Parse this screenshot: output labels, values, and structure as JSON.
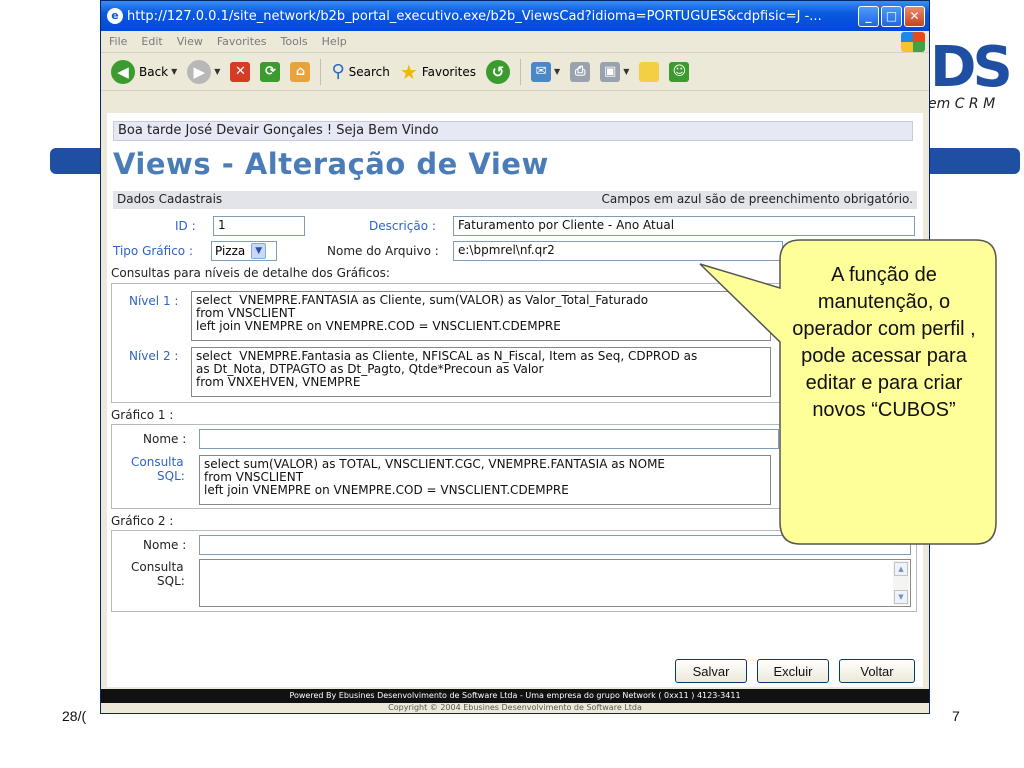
{
  "browser": {
    "title": "http://127.0.0.1/site_network/b2b_portal_executivo.exe/b2b_ViewsCad?idioma=PORTUGUES&cdpfisic=J -...",
    "menu": [
      "File",
      "Edit",
      "View",
      "Favorites",
      "Tools",
      "Help"
    ],
    "toolbar": {
      "back": "Back",
      "search": "Search",
      "favorites": "Favorites"
    }
  },
  "page": {
    "greeting": "Boa tarde José Devair Gonçales ! Seja Bem Vindo",
    "title": "Views - Alteração de View",
    "section_dados": "Dados Cadastrais",
    "required_note": "Campos em azul são de preenchimento obrigatório.",
    "id_label": "ID :",
    "id_value": "1",
    "descricao_label": "Descrição :",
    "descricao_value": "Faturamento por Cliente - Ano Atual",
    "tipo_label": "Tipo Gráfico :",
    "tipo_value": "Pizza",
    "arquivo_label": "Nome do Arquivo :",
    "arquivo_value": "e:\\bpmrel\\nf.qr2",
    "consultas_label": "Consultas para níveis de detalhe dos Gráficos:",
    "nivel1_label": "Nível 1 :",
    "nivel1_sql": "select  VNEMPRE.FANTASIA as Cliente, sum(VALOR) as Valor_Total_Faturado\nfrom VNSCLIENT\nleft join VNEMPRE on VNEMPRE.COD = VNSCLIENT.CDEMPRE",
    "nivel2_label": "Nível 2 :",
    "nivel2_sql": "select  VNEMPRE.Fantasia as Cliente, NFISCAL as N_Fiscal, Item as Seq, CDPROD as\nas Dt_Nota, DTPAGTO as Dt_Pagto, Qtde*Precoun as Valor\nfrom VNXEHVEN, VNEMPRE",
    "grafico1_label": "Gráfico 1 :",
    "nome_label": "Nome :",
    "consulta_label": "Consulta",
    "sql_label": "SQL:",
    "grafico1_sql": "select sum(VALOR) as TOTAL, VNSCLIENT.CGC, VNEMPRE.FANTASIA as NOME\nfrom VNSCLIENT\nleft join VNEMPRE on VNEMPRE.COD = VNSCLIENT.CDEMPRE",
    "grafico2_label": "Gráfico 2 :",
    "salvar": "Salvar",
    "excluir": "Excluir",
    "voltar": "Voltar",
    "powered": "Powered By Ebusines Desenvolvimento de Software Ltda - Uma empresa do grupo Network ( 0xx11 ) 4123-3411",
    "copyright": "Copyright © 2004 Ebusines Desenvolvimento de Software Ltda"
  },
  "slide": {
    "logo_fragment": "DS",
    "slogan_fragment": "em C R M",
    "date_fragment": "28/(",
    "page_number": "7",
    "callout_text": "A função de manutenção, o operador com perfil , pode acessar para editar e para criar novos “CUBOS”",
    "colors": {
      "brand_blue": "#1e4fa3",
      "callout_fill": "#ffff99"
    }
  }
}
